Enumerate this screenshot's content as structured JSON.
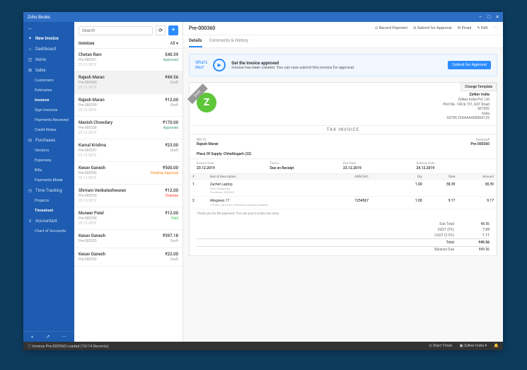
{
  "titlebar": {
    "title": "Zoho Books",
    "minimize": "−",
    "maximize": "□",
    "close": "×"
  },
  "sidebar": {
    "back": "←",
    "new": "New Invoice",
    "items": [
      {
        "icon": "⌂",
        "label": "Dashboard"
      },
      {
        "icon": "◫",
        "label": "Items"
      }
    ],
    "sales": {
      "icon": "⊞",
      "label": "Sales",
      "subs": [
        "Customers",
        "Estimates",
        "Invoices",
        "Sign Invoices",
        "Payments Received",
        "Credit Notes"
      ]
    },
    "purchases": {
      "icon": "⊟",
      "label": "Purchases",
      "subs": [
        "Vendors",
        "Expenses",
        "Bills",
        "Payments Made"
      ]
    },
    "time": {
      "icon": "◷",
      "label": "Time Tracking",
      "subs": [
        "Projects",
        "Timesheet"
      ]
    },
    "accountant": {
      "icon": "≡",
      "label": "Accountant",
      "subs": [
        "Chart of Accounts"
      ]
    },
    "bottom": [
      "◐",
      "↗",
      "⋯"
    ]
  },
  "list": {
    "search_ph": "Search",
    "title": "Invoices",
    "filter": "All ▾",
    "items": [
      {
        "name": "Chetan Ram",
        "amt": "$40.39",
        "ref": "Pre-000361",
        "status": "Approved",
        "scls": "st-approved",
        "date": "23.12.2019"
      },
      {
        "name": "Rajesh Maran",
        "amt": "₹49.56",
        "ref": "Pre-000360",
        "status": "Draft",
        "scls": "st-draft",
        "date": "23.12.2019",
        "sel": true
      },
      {
        "name": "Rajesh Maran",
        "amt": "₹12.00",
        "ref": "Pre-000359",
        "status": "Draft",
        "scls": "st-draft",
        "date": "23.12.2019"
      },
      {
        "name": "Manish Chowdary",
        "amt": "₹170.00",
        "ref": "Pre-000358",
        "status": "Approved",
        "scls": "st-approved",
        "date": "23.12.2019"
      },
      {
        "name": "Kamal Krishna",
        "amt": "₹23.00",
        "ref": "Pre-000357",
        "status": "Draft",
        "scls": "st-draft",
        "date": "23.12.2019"
      },
      {
        "name": "Kesav Ganesh",
        "amt": "₹500.00",
        "ref": "Pre-000356",
        "status": "Pending Approval",
        "scls": "st-pending",
        "date": "23.12.2019"
      },
      {
        "name": "Shriram Venkateshwaran",
        "amt": "₹12.00",
        "ref": "Pre-000355",
        "status": "Overdue",
        "scls": "st-overdue",
        "date": "20.12.2019"
      },
      {
        "name": "Muneer Patel",
        "amt": "₹12.00",
        "ref": "Pre-000354",
        "status": "Paid",
        "scls": "st-paid",
        "date": "20.12.2019"
      },
      {
        "name": "Kesav Ganesh",
        "amt": "₹597.18",
        "ref": "Pre-000353",
        "status": "Draft",
        "scls": "st-draft",
        "date": ""
      },
      {
        "name": "Kesav Ganesh",
        "amt": "₹22.00",
        "ref": "Pre-000352",
        "status": "Draft",
        "scls": "st-draft",
        "date": ""
      }
    ]
  },
  "detail": {
    "title": "Pre-000360",
    "actions": [
      "⊙ Record Payment",
      "⊘ Submit for Approval",
      "✉ Email",
      "✎ Edit",
      "⋯"
    ],
    "tabs": [
      "Details",
      "Comments & History"
    ],
    "banner": {
      "wn": "What's\nNext",
      "head": "Get the invoice approved",
      "body": "Invoice has been created. You can now submit this invoice for approval.",
      "btn": "Submit for Approval"
    },
    "change": "Change Template",
    "draft": "Draft",
    "company": {
      "name": "Zylker India",
      "line2": "Zylkes India Pvt. Ltd",
      "line3": "Plot No. 140 & 151, GST Road",
      "city": "601302",
      "country": "India",
      "gstin": "GSTIN 22AAAAA0000A1Z5"
    },
    "tax": "TAX INVOICE",
    "billto_l": "Bill To",
    "billto": "Rajesh Maran",
    "invno_l": "Invoice#",
    "invno": "Pre-000360",
    "supply": "Place Of Supply: Chhattisgarh (22)",
    "dates": [
      {
        "l": "Invoice Date",
        "v": "23.12.2019"
      },
      {
        "l": "Terms",
        "v": "Due on Receipt"
      },
      {
        "l": "Due Date",
        "v": "23.12.2019"
      },
      {
        "l": "Delivery Date",
        "v": "24.12.2019"
      }
    ],
    "th": [
      "#",
      "Item & Description",
      "HSN/SAC",
      "Qty",
      "Rate",
      "Amount"
    ],
    "rows": [
      {
        "n": "1",
        "desc": "Zachet Laptop",
        "sub": "Color: Burgundy\nProcessor: i5G2441",
        "hsn": "",
        "qty": "1.00",
        "rate": "38.39",
        "amt": "38.39"
      },
      {
        "n": "2",
        "desc": "Allegrean 17",
        "sub": "110 lbs | 43.0 inch | Wireless charging enabled",
        "hsn": "1234567",
        "qty": "1.00",
        "rate": "9.17",
        "amt": "9.17"
      }
    ],
    "thanks": "Thank you for the payment. You can pay in online too easy.",
    "totals": [
      {
        "l": "Sub Total",
        "v": "48.56"
      },
      {
        "l": "SGST (9%)",
        "v": "7.69"
      },
      {
        "l": "CGST (2.5%)",
        "v": "1.11"
      }
    ],
    "total": {
      "l": "Total",
      "v": "₹49.56"
    },
    "bal": {
      "l": "Balance Due",
      "v": "₹49.56"
    }
  },
  "status": {
    "left": "Invoice Pre-000360 Loaded (10/14 Records)",
    "timer": "◷ Start Timer",
    "org": "▣ Zylker India ▾",
    "bell": "🔔"
  }
}
